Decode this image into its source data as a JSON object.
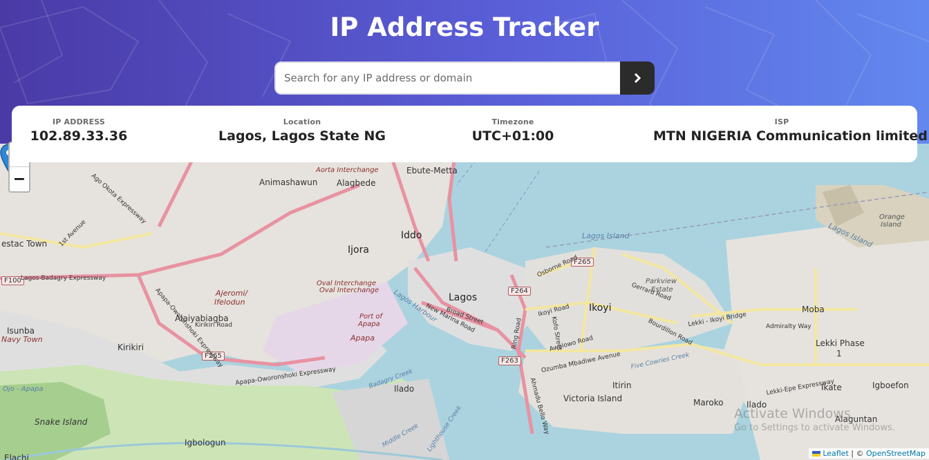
{
  "header": {
    "title": "IP Address Tracker",
    "search_placeholder": "Search for any IP address or domain",
    "search_button_icon": "chevron-right-icon"
  },
  "info": {
    "ip": {
      "label": "IP ADDRESS",
      "value": "102.89.33.36"
    },
    "location": {
      "label": "Location",
      "value": "Lagos, Lagos State NG"
    },
    "timezone": {
      "label": "Timezone",
      "value": "UTC+01:00"
    },
    "isp": {
      "label": "ISP",
      "value": "MTN NIGERIA Communication limited"
    }
  },
  "map": {
    "zoom_in": "+",
    "zoom_out": "−",
    "labels": {
      "ebute_metta": "Ebute-Metta",
      "animashawun": "Animashawun",
      "alagbede": "Alagbede",
      "aorta": "Aorta Interchange",
      "iddo": "Iddo",
      "ijora": "Ijora",
      "estac_town": "estac Town",
      "oval1": "Oval Interchange",
      "oval2": "Oval Interchange",
      "ajeromi": "Ajeromi/",
      "ifelodun": "Ifelodun",
      "lagos": "Lagos",
      "alaiyabiagba": "Alaiyabiagba",
      "kirikiri_road": "Kirikiri Road",
      "isunba": "Isunba",
      "navy_town": "Navy Town",
      "kirikiri": "Kirikiri",
      "apapa": "Apapa",
      "port_apapa": "Port of",
      "port_apapa2": "Apapa",
      "ilado": "Ilado",
      "snake_island": "Snake Island",
      "igbologun": "Igbologun",
      "elachi": "Elachi",
      "ikoyi": "Ikoyi",
      "parkview": "Parkview",
      "estate": "Estate",
      "moba": "Moba",
      "lekki": "Lekki Phase",
      "lekki1": "1",
      "orange1": "Orange",
      "orange2": "Island",
      "lagos_island": "Lagos Island",
      "lagos_island2": "Lagos Island",
      "victoria": "Victoria Island",
      "itirin": "Itirin",
      "maroko": "Maroko",
      "ilado2": "Ilado",
      "ikate": "Ikate",
      "igboefon": "Igboefon",
      "alaguntan": "Alaguntan",
      "lagos_harbour": "Lagos Harbour",
      "five_cowries": "Five Cowries Creek",
      "badagry": "Badagry Creek",
      "lighthouse": "Lighthouse Creek",
      "middle_creek": "Middle Creek",
      "ojo_apapa": "Ojo - Apapa"
    },
    "shields": {
      "f100": "F100",
      "f265a": "F265",
      "f265b": "F265",
      "f264": "F264",
      "f263": "F263"
    },
    "roads": {
      "badagry_exp": "Lagos-Badagry Expressway",
      "broad": "Broad Street",
      "marina": "New Marina Road",
      "lekki_epe": "Lekki-Epe Expressway",
      "admiralty": "Admiralty Way",
      "ozumba": "Ozumba Mbadiwe Avenue",
      "osborne": "Osborne Road",
      "awolowo": "Awolowo Road",
      "gerrard": "Gerrard Road",
      "bourdillon": "Bourdillon Road",
      "ikoyi_rd": "Ikoyi Road",
      "kofo": "Kofo Street",
      "lekki_ikoyi": "Lekki - Ikoyi Bridge",
      "apapa_ow": "Apapa-Oworonshoki Expressway",
      "apapa_ow2": "Apapa-Oworonshoki Expressway",
      "ahmadu": "Ahmadu Bello Way",
      "bridge_rd": "Ring Road",
      "ago_okota": "Ago Okota Expressway",
      "first_ave": "1st Avenue"
    },
    "attribution": {
      "leaflet": "Leaflet",
      "sep": " | © ",
      "osm": "OpenStreetMap"
    },
    "watermark": {
      "line1": "Activate Windows",
      "line2": "Go to Settings to activate Windows."
    },
    "colors": {
      "water": "#aad3df",
      "land": "#f2efe9",
      "urban": "#e0dfdf",
      "major_road": "#e892a2",
      "secondary_road": "#f7fabf",
      "park": "#c8e6a7",
      "header_start": "#4a3aa6",
      "header_end": "#6288ee",
      "pin": "#2f86d6"
    }
  }
}
